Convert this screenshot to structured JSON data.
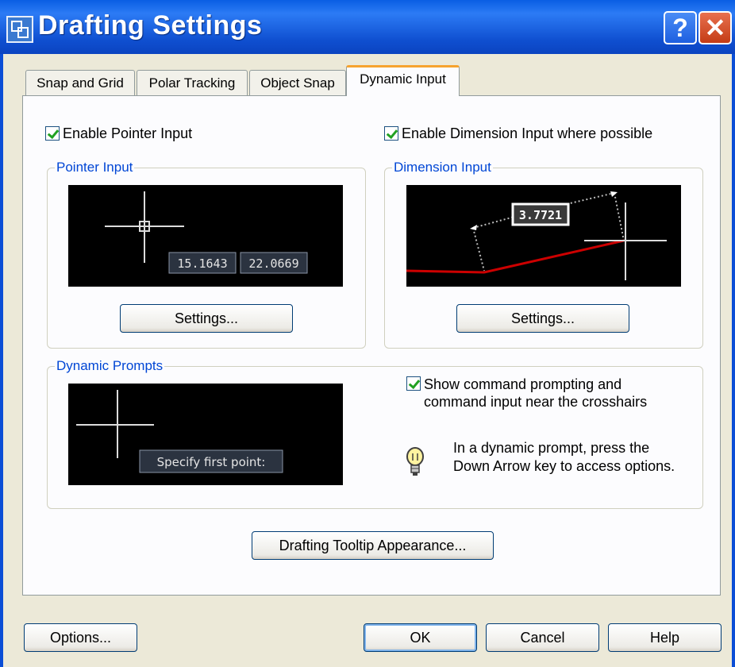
{
  "window": {
    "title": "Drafting Settings",
    "help_label": "?",
    "close_label": "✕"
  },
  "tabs": [
    {
      "label": "Snap and Grid"
    },
    {
      "label": "Polar Tracking"
    },
    {
      "label": "Object Snap"
    },
    {
      "label": "Dynamic Input",
      "active": true
    }
  ],
  "pointer": {
    "enable_label": "Enable Pointer Input",
    "group_title": "Pointer Input",
    "coord_x": "15.1643",
    "coord_y": "22.0669",
    "settings_label": "Settings..."
  },
  "dimension": {
    "enable_label": "Enable Dimension Input where possible",
    "group_title": "Dimension Input",
    "value": "3.7721",
    "settings_label": "Settings..."
  },
  "prompts": {
    "group_title": "Dynamic Prompts",
    "preview_text": "Specify first point:",
    "show_label_line1": "Show command prompting and",
    "show_label_line2": "command input near the crosshairs",
    "hint_line1": "In a dynamic prompt, press the",
    "hint_line2": "Down Arrow key to access options."
  },
  "tooltip_button": "Drafting Tooltip Appearance...",
  "footer": {
    "options": "Options...",
    "ok": "OK",
    "cancel": "Cancel",
    "help": "Help"
  },
  "colors": {
    "titlebar": "#0a5ee3",
    "accent_tab": "#F6A32E",
    "group_title": "#0046d5",
    "dimension_line": "#cc0000"
  }
}
